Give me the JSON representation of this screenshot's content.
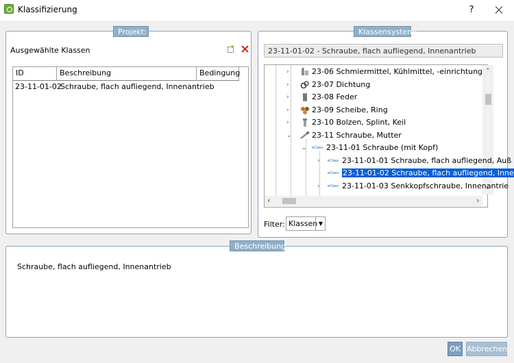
{
  "window": {
    "title": "Klassifizierung",
    "help": "?"
  },
  "projekt": {
    "group_title": "Projekt:",
    "selected_title": "Ausgewählte Klassen",
    "columns": [
      "ID",
      "Beschreibung",
      "Bedingung"
    ],
    "rows": [
      {
        "id": "23-11-01-02",
        "beschreibung": "Schraube, flach aufliegend, Innenantrieb",
        "bedingung": ""
      }
    ]
  },
  "klassensystem": {
    "group_title": "Klassensystem:",
    "path": "23-11-01-02 - Schraube, flach aufliegend, Innenantrieb",
    "tree": [
      {
        "label": "23-06 Schmiermittel, Kühlmittel, -einrichtung",
        "icon": "lubricant-icon"
      },
      {
        "label": "23-07 Dichtung",
        "icon": "seal-icon"
      },
      {
        "label": "23-08 Feder",
        "icon": "spring-icon"
      },
      {
        "label": "23-09 Scheibe, Ring",
        "icon": "washer-icon"
      },
      {
        "label": "23-10 Bolzen, Splint, Keil",
        "icon": "bolt-icon"
      },
      {
        "label": "23-11 Schraube, Mutter",
        "icon": "screw-icon"
      },
      {
        "label": "23-11-01 Schraube (mit Kopf)",
        "icon": "eclass-icon"
      },
      {
        "label": "23-11-01-01 Schraube, flach aufliegend, Auß",
        "icon": "eclass-icon"
      },
      {
        "label": "23-11-01-02 Schraube, flach aufliegend, Inne",
        "icon": "eclass-icon",
        "selected": true
      },
      {
        "label": "23-11-01-03 Senkkopfschraube, Innenantrie",
        "icon": "eclass-icon"
      }
    ],
    "eclass_text": "eClass",
    "filter_label": "Filter:",
    "filter_value": "Klassen"
  },
  "beschreibung": {
    "group_title": "Beschreibung",
    "text": "Schraube, flach aufliegend, Innenantrieb"
  },
  "buttons": {
    "ok": "OK",
    "cancel": "Abbrechen"
  }
}
